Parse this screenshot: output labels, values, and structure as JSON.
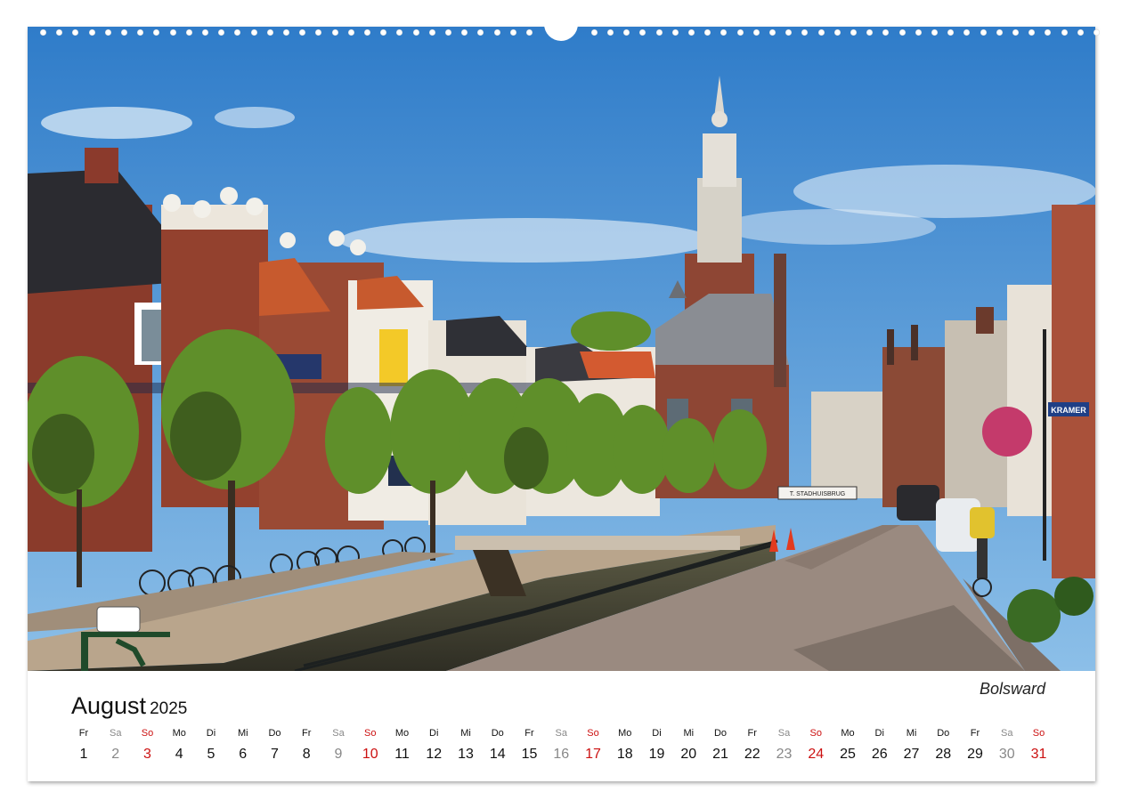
{
  "calendar": {
    "month": "August",
    "year": "2025",
    "place": "Bolsward",
    "colors": {
      "weekday": "#111111",
      "saturday": "#888888",
      "sunday": "#cc1111"
    },
    "days": [
      {
        "wd": "Fr",
        "d": "1",
        "t": "w"
      },
      {
        "wd": "Sa",
        "d": "2",
        "t": "sat"
      },
      {
        "wd": "So",
        "d": "3",
        "t": "sun"
      },
      {
        "wd": "Mo",
        "d": "4",
        "t": "w"
      },
      {
        "wd": "Di",
        "d": "5",
        "t": "w"
      },
      {
        "wd": "Mi",
        "d": "6",
        "t": "w"
      },
      {
        "wd": "Do",
        "d": "7",
        "t": "w"
      },
      {
        "wd": "Fr",
        "d": "8",
        "t": "w"
      },
      {
        "wd": "Sa",
        "d": "9",
        "t": "sat"
      },
      {
        "wd": "So",
        "d": "10",
        "t": "sun"
      },
      {
        "wd": "Mo",
        "d": "11",
        "t": "w"
      },
      {
        "wd": "Di",
        "d": "12",
        "t": "w"
      },
      {
        "wd": "Mi",
        "d": "13",
        "t": "w"
      },
      {
        "wd": "Do",
        "d": "14",
        "t": "w"
      },
      {
        "wd": "Fr",
        "d": "15",
        "t": "w"
      },
      {
        "wd": "Sa",
        "d": "16",
        "t": "sat"
      },
      {
        "wd": "So",
        "d": "17",
        "t": "sun"
      },
      {
        "wd": "Mo",
        "d": "18",
        "t": "w"
      },
      {
        "wd": "Di",
        "d": "19",
        "t": "w"
      },
      {
        "wd": "Mi",
        "d": "20",
        "t": "w"
      },
      {
        "wd": "Do",
        "d": "21",
        "t": "w"
      },
      {
        "wd": "Fr",
        "d": "22",
        "t": "w"
      },
      {
        "wd": "Sa",
        "d": "23",
        "t": "sat"
      },
      {
        "wd": "So",
        "d": "24",
        "t": "sun"
      },
      {
        "wd": "Mo",
        "d": "25",
        "t": "w"
      },
      {
        "wd": "Di",
        "d": "26",
        "t": "w"
      },
      {
        "wd": "Mi",
        "d": "27",
        "t": "w"
      },
      {
        "wd": "Do",
        "d": "28",
        "t": "w"
      },
      {
        "wd": "Fr",
        "d": "29",
        "t": "w"
      },
      {
        "wd": "Sa",
        "d": "30",
        "t": "sat"
      },
      {
        "wd": "So",
        "d": "31",
        "t": "sun"
      }
    ]
  },
  "photo": {
    "signs": {
      "shop": "KRAMER",
      "bridge": "T. STADHUISBRUG"
    },
    "colors": {
      "sky": "#3f88d1",
      "brick": "#8a3b2b",
      "trees": "#5f8f2a",
      "street": "#9a8a80"
    }
  }
}
